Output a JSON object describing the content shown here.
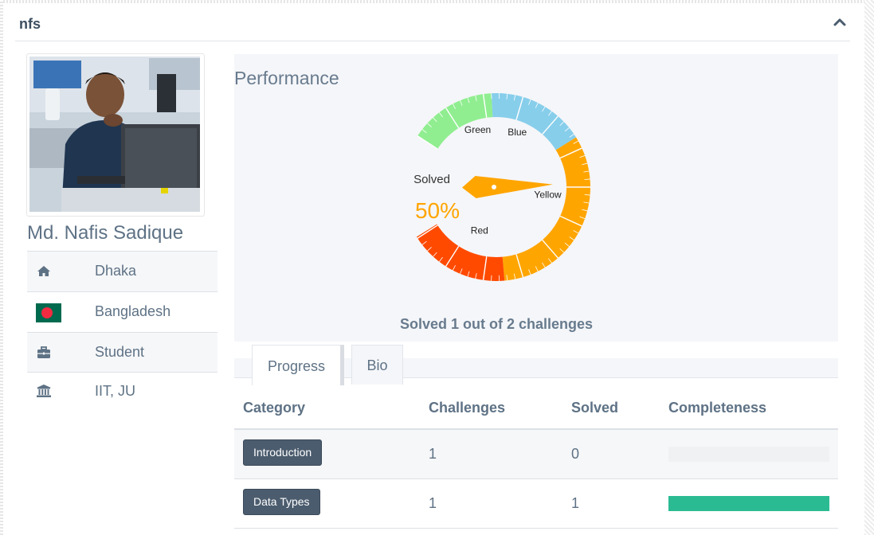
{
  "panel": {
    "title": "nfs"
  },
  "profile": {
    "name": "Md. Nafis Sadique",
    "info": [
      {
        "icon": "home-icon",
        "text": "Dhaka"
      },
      {
        "icon": "bangladesh-flag-icon",
        "text": "Bangladesh"
      },
      {
        "icon": "briefcase-icon",
        "text": "Student"
      },
      {
        "icon": "institution-icon",
        "text": "IIT, JU"
      }
    ]
  },
  "performance": {
    "title": "Performance",
    "gauge": {
      "label": "Solved",
      "value_text": "50%",
      "value": 50,
      "bands": [
        {
          "name": "Red",
          "color": "#ff4a00"
        },
        {
          "name": "Yellow",
          "color": "#ffa500"
        },
        {
          "name": "Blue",
          "color": "#87ceeb"
        },
        {
          "name": "Green",
          "color": "#90ee90"
        }
      ]
    },
    "summary": "Solved 1 out of 2 challenges"
  },
  "tabs": [
    {
      "label": "Progress",
      "active": true
    },
    {
      "label": "Bio",
      "active": false
    }
  ],
  "progress_table": {
    "headers": [
      "Category",
      "Challenges",
      "Solved",
      "Completeness"
    ],
    "rows": [
      {
        "category": "Introduction",
        "challenges": "1",
        "solved": "0",
        "completeness": 0
      },
      {
        "category": "Data Types",
        "challenges": "1",
        "solved": "1",
        "completeness": 1
      }
    ]
  },
  "colors": {
    "accent": "#ffa500",
    "progress_fill": "#2bbb93",
    "category_button": "#4b5c6e"
  }
}
